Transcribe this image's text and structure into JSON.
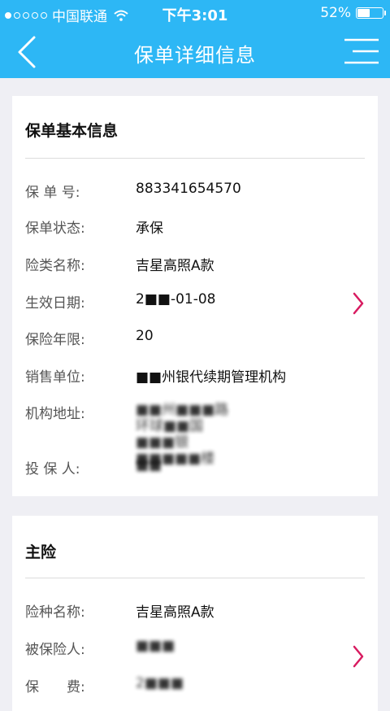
{
  "status": {
    "carrier": "中国联通",
    "time": "下午3:01",
    "battery": "52%",
    "battery_level": 0.52
  },
  "nav": {
    "title": "保单详细信息"
  },
  "basic": {
    "title": "保单基本信息",
    "rows": [
      {
        "label": "保 单 号:",
        "value": "883341654570"
      },
      {
        "label": "保单状态:",
        "value": "承保"
      },
      {
        "label": "险类名称:",
        "value": "吉星高照A款"
      },
      {
        "label": "生效日期:",
        "value": "2■■-01-08"
      },
      {
        "label": "保险年限:",
        "value": "20"
      },
      {
        "label": "销售单位:",
        "value": "■■州银代续期管理机构"
      },
      {
        "label": "机构地址:",
        "value": "■■州■■■路环球■■国■■■银■■■■■楼"
      },
      {
        "label": "投 保 人:",
        "value": "■■"
      }
    ]
  },
  "main": {
    "title": "主险",
    "rows": [
      {
        "label": "险种名称:",
        "value": "吉星高照A款"
      },
      {
        "label": "被保险人:",
        "value": "■■■"
      },
      {
        "label": "保　　费:",
        "value": "2■■■"
      }
    ]
  }
}
